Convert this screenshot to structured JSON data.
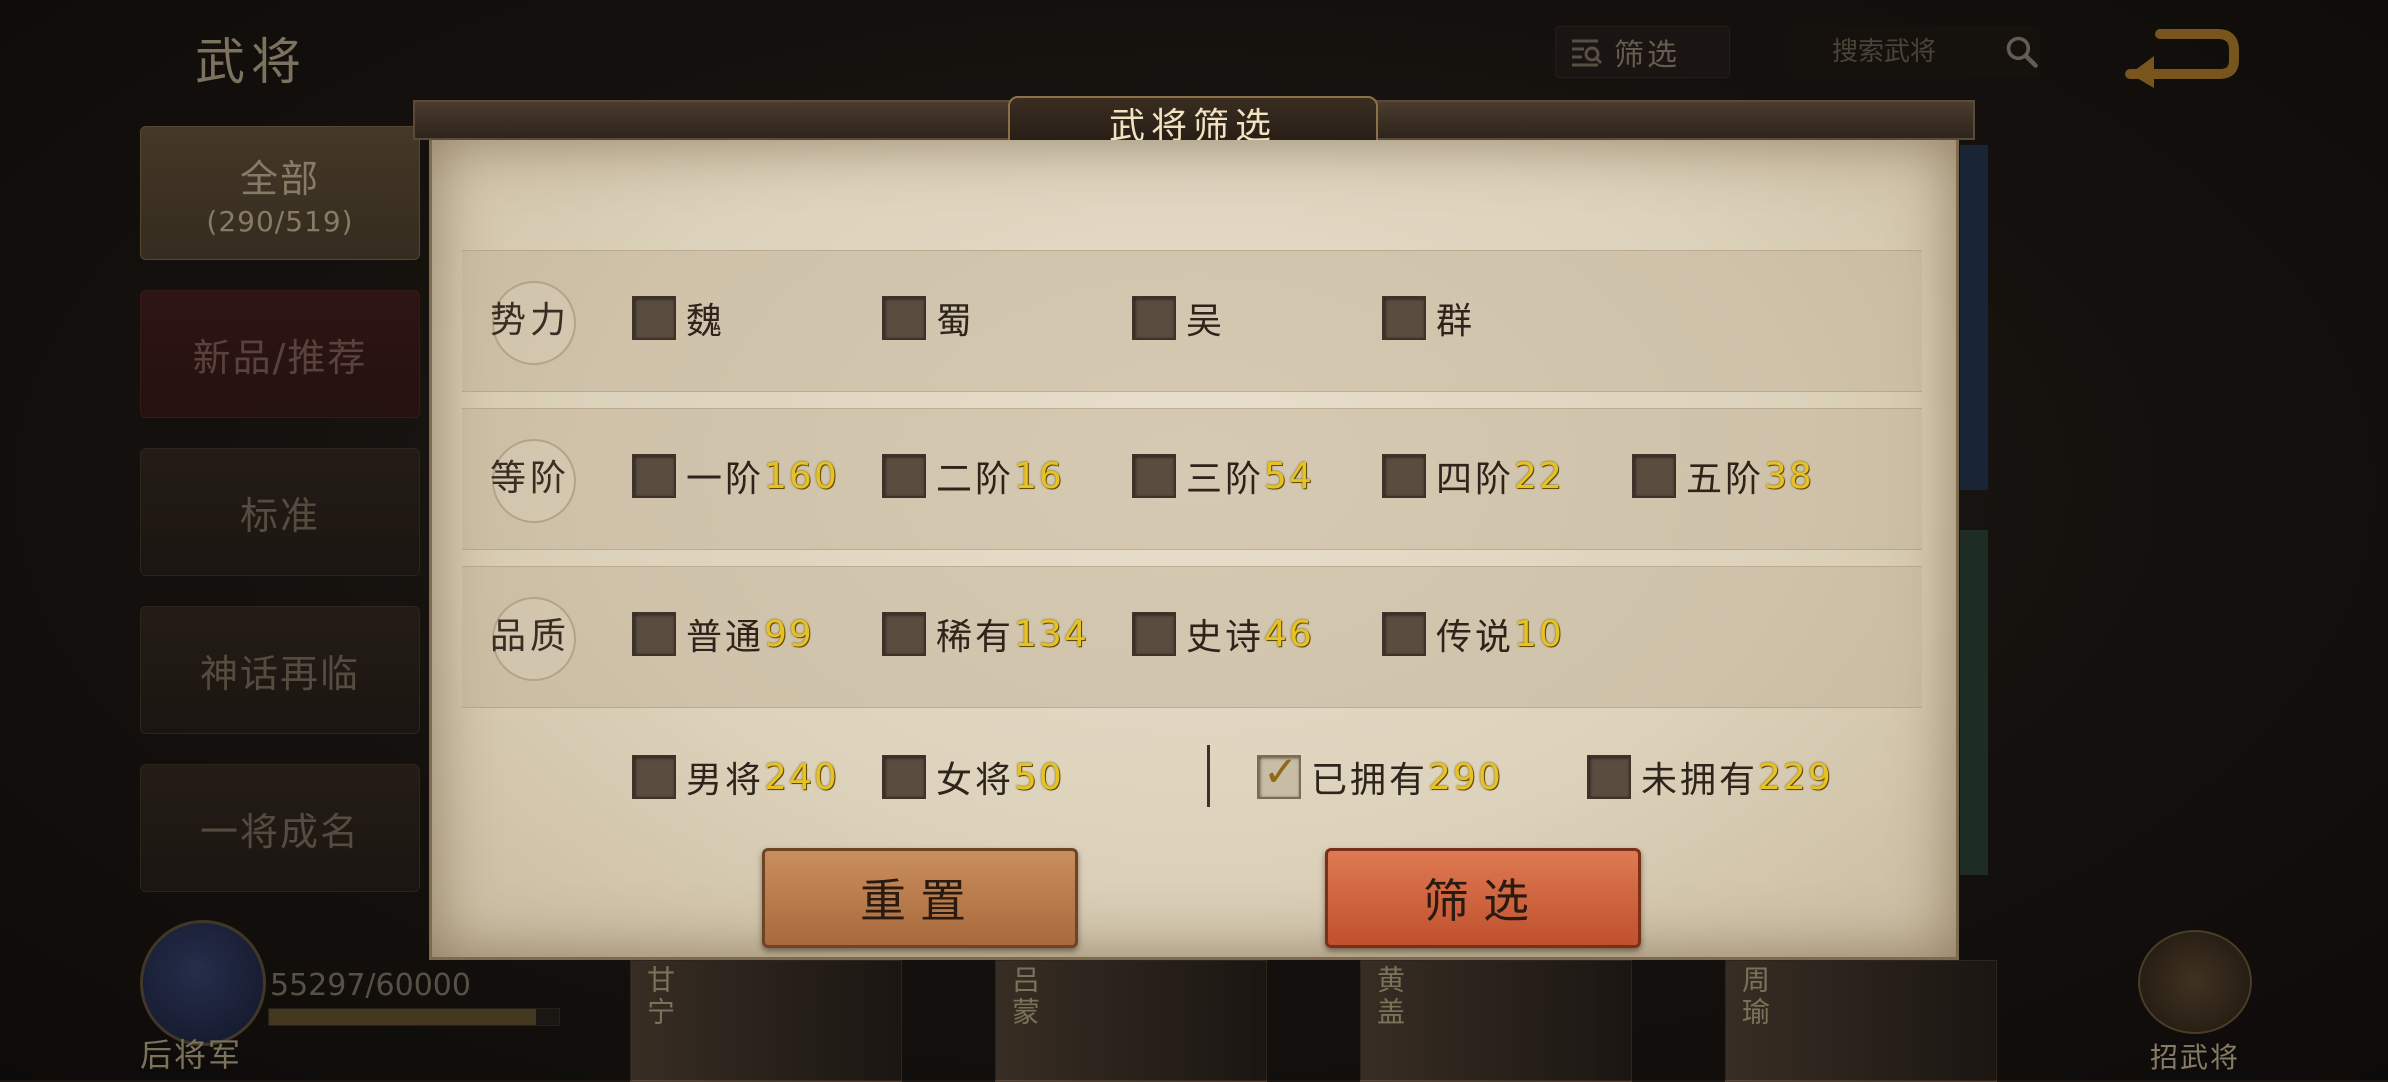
{
  "header": {
    "title": "武将",
    "filter_label": "筛选",
    "search_placeholder": "搜索武将"
  },
  "sidebar": {
    "items": [
      {
        "label": "全部",
        "sub": "(290/519)"
      },
      {
        "label": "新品/推荐"
      },
      {
        "label": "标准"
      },
      {
        "label": "神话再临"
      },
      {
        "label": "一将成名"
      }
    ]
  },
  "rank": {
    "title": "后将军",
    "exp": "55297/60000",
    "progress": 0.92
  },
  "cards": [
    "甘宁",
    "吕蒙",
    "黄盖",
    "周瑜"
  ],
  "recruit_label": "招武将",
  "modal": {
    "title": "武将筛选",
    "faction": {
      "label": "势力",
      "options": [
        {
          "name": "魏",
          "checked": false
        },
        {
          "name": "蜀",
          "checked": false
        },
        {
          "name": "吴",
          "checked": false
        },
        {
          "name": "群",
          "checked": false
        }
      ]
    },
    "tier": {
      "label": "等阶",
      "options": [
        {
          "name": "一阶",
          "count": "160",
          "checked": false
        },
        {
          "name": "二阶",
          "count": "16",
          "checked": false
        },
        {
          "name": "三阶",
          "count": "54",
          "checked": false
        },
        {
          "name": "四阶",
          "count": "22",
          "checked": false
        },
        {
          "name": "五阶",
          "count": "38",
          "checked": false
        }
      ]
    },
    "quality": {
      "label": "品质",
      "options": [
        {
          "name": "普通",
          "count": "99",
          "checked": false
        },
        {
          "name": "稀有",
          "count": "134",
          "checked": false
        },
        {
          "name": "史诗",
          "count": "46",
          "checked": false
        },
        {
          "name": "传说",
          "count": "10",
          "checked": false
        }
      ]
    },
    "misc": {
      "options": [
        {
          "name": "男将",
          "count": "240",
          "checked": false
        },
        {
          "name": "女将",
          "count": "50",
          "checked": false
        },
        {
          "name": "已拥有",
          "count": "290",
          "checked": true
        },
        {
          "name": "未拥有",
          "count": "229",
          "checked": false
        }
      ]
    },
    "reset_label": "重置",
    "apply_label": "筛选"
  },
  "colors": {
    "count_yellow": "#e6c224",
    "apply_button": "#d0603a",
    "reset_button": "#b97a4a",
    "parchment": "#e1d6c0"
  }
}
